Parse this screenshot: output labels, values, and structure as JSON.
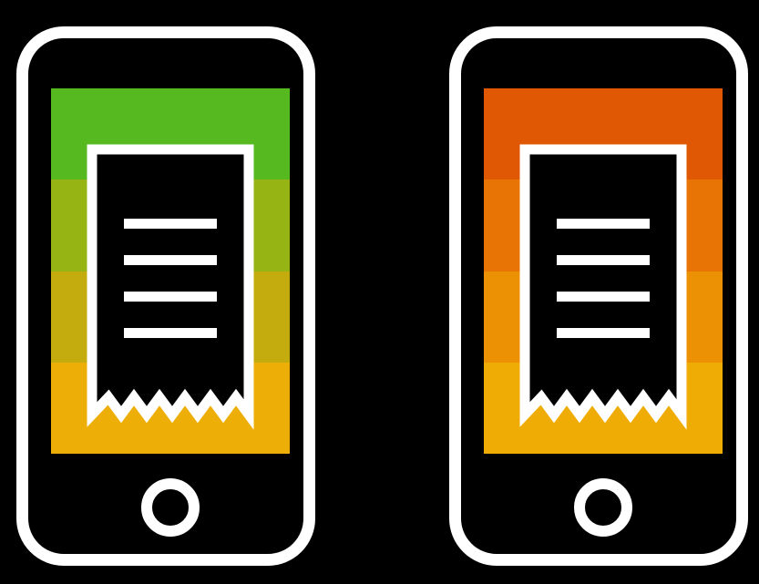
{
  "phones": [
    {
      "id": "left",
      "screen_bands": [
        "#55b91f",
        "#96b414",
        "#c4ac0e",
        "#ecae07"
      ]
    },
    {
      "id": "right",
      "screen_bands": [
        "#e05704",
        "#e87405",
        "#ec9004",
        "#eeac04"
      ]
    }
  ],
  "colors": {
    "background": "#000000",
    "outline": "#ffffff",
    "receipt_fill": "#000000"
  },
  "icons": {
    "device": "smartphone-icon",
    "document": "receipt-icon",
    "home": "home-button-icon"
  }
}
